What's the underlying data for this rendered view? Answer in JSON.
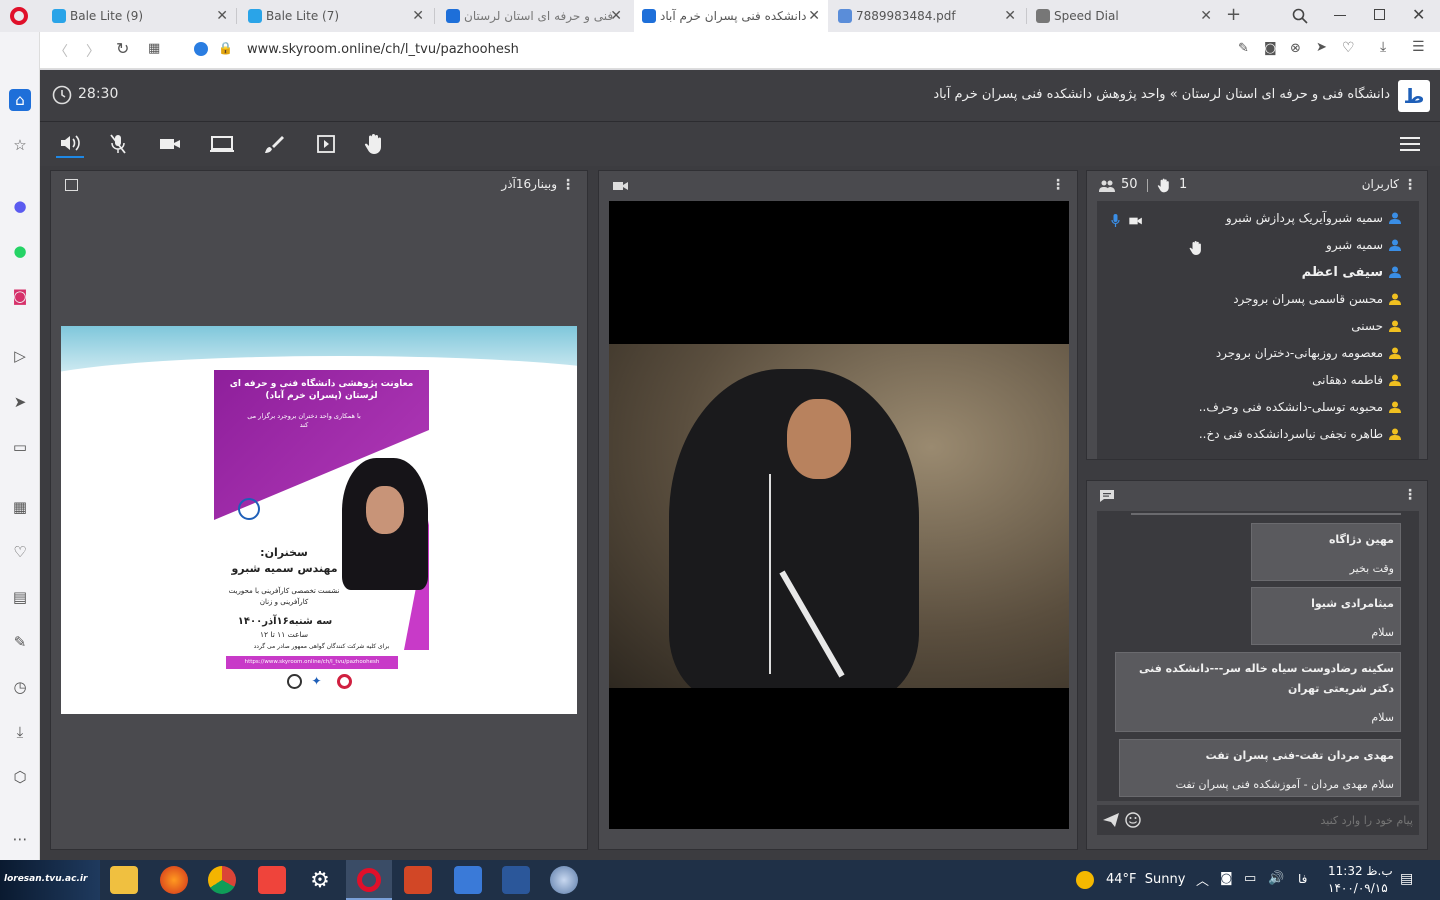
{
  "browser": {
    "tabs": [
      {
        "title": "Bale Lite (9)",
        "color": "#2aa4e8"
      },
      {
        "title": "Bale Lite (7)",
        "color": "#2aa4e8"
      },
      {
        "title": "فنی و حرفه ای استان لرستان",
        "color": "#1e6fd9"
      },
      {
        "title": "دانشکده فنی پسران خرم آباد",
        "color": "#1e6fd9"
      },
      {
        "title": "7889983484.pdf",
        "color": "#5a8dd9"
      },
      {
        "title": "Speed Dial",
        "color": "#666"
      }
    ],
    "url": "www.skyroom.online/ch/l_tvu/pazhoohesh"
  },
  "app": {
    "timer": "28:30",
    "title": "دانشگاه فنی و حرفه ای استان لرستان » واحد پژوهش دانشکده فنی پسران خرم آباد",
    "presentation_title": "وبینار16آذر",
    "users_label": "کاربران",
    "users_count": "50",
    "raised_hands": "1",
    "users": [
      {
        "name": "سمیه شبروآیریک پردازش شبرو",
        "color": "#3a8ee6",
        "bold": false
      },
      {
        "name": "سمیه شبرو",
        "color": "#3a8ee6",
        "bold": false
      },
      {
        "name": "سیفی اعظم",
        "color": "#3a8ee6",
        "bold": true
      },
      {
        "name": "محسن قاسمی پسران بروجرد",
        "color": "#f0c020",
        "bold": false
      },
      {
        "name": "حسنی",
        "color": "#f0c020",
        "bold": false
      },
      {
        "name": "معصومه روزبهانی-دختران بروجرد",
        "color": "#f0c020",
        "bold": false
      },
      {
        "name": "فاطمه دهقانی",
        "color": "#f0c020",
        "bold": false
      },
      {
        "name": "محبوبه توسلی-دانشکده فنی وحرف..",
        "color": "#f0c020",
        "bold": false
      },
      {
        "name": "طاهره نجفی نیاسردانشکده فنی دخ..",
        "color": "#f0c020",
        "bold": false
      }
    ],
    "chat": [
      {
        "name": "مهین دژاگاه",
        "text": "وقت بخیر"
      },
      {
        "name": "میثامرادی شیوا",
        "text": "سلام"
      },
      {
        "name": "سکینه رضادوست سیاه خاله سر---دانشکده فنی دکتر شریعتی تهران",
        "text": "سلام"
      },
      {
        "name": "مهدی مردان تفت-فنی پسران تفت",
        "text": "سلام مهدی مردان - آموزشکده فنی پسران تفت"
      }
    ],
    "chat_placeholder": "پیام خود را وارد کنید"
  },
  "poster": {
    "heading": "معاونت پژوهشی دانشگاه فنی و حرفه ای لرستان (پسران خرم آباد)",
    "subheading": "با همکاری واحد دختران بروجرد برگزار می کند",
    "speaker_label": "سخنران:",
    "speaker": "مهندس سمیه شبرو",
    "topic": "نشست تخصصی کارآفرینی با محوریت کارآفرینی و زنان",
    "date": "سه شنبه۱۶آذر۱۴۰۰",
    "time": "ساعت ۱۱ تا ۱۲",
    "certificate": "برای کلیه شرکت کنندگان گواهی ممهور صادر می گردد",
    "link": "https://www.skyroom.online/ch/l_tvu/pazhoohesh"
  },
  "taskbar": {
    "weather": "44°F  Sunny",
    "lang": "فا",
    "time": "11:32 ب.ظ",
    "date": "۱۴۰۰/۰۹/۱۵",
    "logo_text": "loresan.tvu.ac.ir"
  }
}
